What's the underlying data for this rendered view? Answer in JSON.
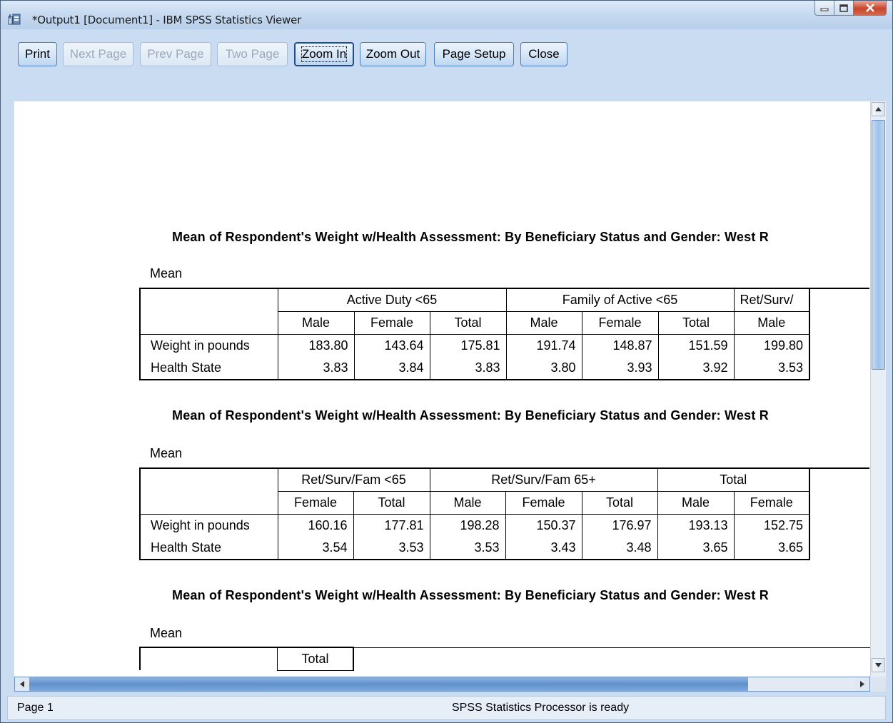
{
  "window": {
    "title": "*Output1 [Document1] - IBM SPSS Statistics Viewer"
  },
  "toolbar": {
    "print": "Print",
    "next_page": "Next Page",
    "prev_page": "Prev Page",
    "two_page": "Two Page",
    "zoom_in": "Zoom In",
    "zoom_out": "Zoom Out",
    "page_setup": "Page Setup",
    "close": "Close"
  },
  "tables": [
    {
      "title": "Mean of Respondent's Weight w/Health Assessment: By Beneficiary Status and Gender: West R",
      "stat": "Mean",
      "groups": [
        "Active Duty <65",
        "Family of Active <65",
        "Ret/Surv/"
      ],
      "cols": [
        "Male",
        "Female",
        "Total",
        "Male",
        "Female",
        "Total",
        "Male"
      ],
      "rows": [
        {
          "label": "Weight in pounds",
          "values": [
            "183.80",
            "143.64",
            "175.81",
            "191.74",
            "148.87",
            "151.59",
            "199.80"
          ]
        },
        {
          "label": "Health State",
          "values": [
            "3.83",
            "3.84",
            "3.83",
            "3.80",
            "3.93",
            "3.92",
            "3.53"
          ]
        }
      ]
    },
    {
      "title": "Mean of Respondent's Weight w/Health Assessment: By Beneficiary Status and Gender: West R",
      "stat": "Mean",
      "groups": [
        "Ret/Surv/Fam <65",
        "Ret/Surv/Fam 65+",
        "Total"
      ],
      "cols": [
        "Female",
        "Total",
        "Male",
        "Female",
        "Total",
        "Male",
        "Female"
      ],
      "rows": [
        {
          "label": "Weight in pounds",
          "values": [
            "160.16",
            "177.81",
            "198.28",
            "150.37",
            "176.97",
            "193.13",
            "152.75"
          ]
        },
        {
          "label": "Health State",
          "values": [
            "3.54",
            "3.53",
            "3.53",
            "3.43",
            "3.48",
            "3.65",
            "3.65"
          ]
        }
      ]
    },
    {
      "title": "Mean of Respondent's Weight w/Health Assessment: By Beneficiary Status and Gender: West R",
      "stat": "Mean",
      "groups": [
        "Total"
      ]
    }
  ],
  "status": {
    "page": "Page 1",
    "message": "SPSS Statistics Processor is ready"
  }
}
